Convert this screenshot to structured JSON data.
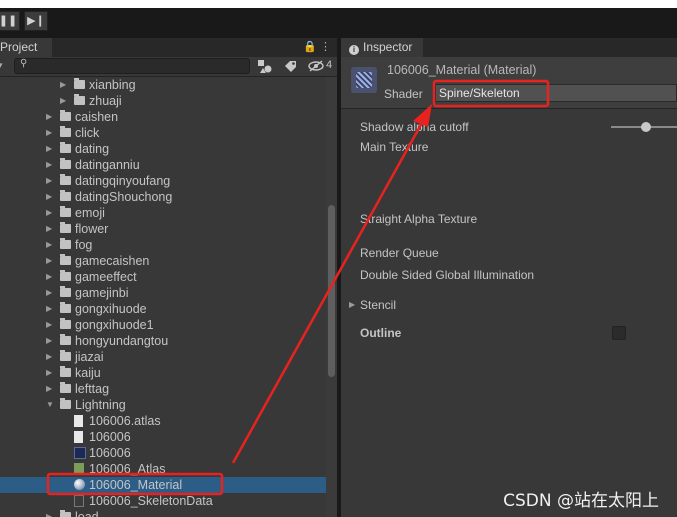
{
  "toolbar": {
    "pause_glyph": "❚❚",
    "step_glyph": "▶❙"
  },
  "project": {
    "tab_label": "Project",
    "tab_icons": "🔒 ⋮",
    "add_glyph": "▾",
    "visible_count": "4",
    "items": [
      {
        "label": "xianbing",
        "type": "folder",
        "depth": 2,
        "expanded": false
      },
      {
        "label": "zhuaji",
        "type": "folder",
        "depth": 2,
        "expanded": false
      },
      {
        "label": "caishen",
        "type": "folder",
        "depth": 1,
        "expanded": false
      },
      {
        "label": "click",
        "type": "folder",
        "depth": 1,
        "expanded": false
      },
      {
        "label": "dating",
        "type": "folder",
        "depth": 1,
        "expanded": false
      },
      {
        "label": "datinganniu",
        "type": "folder",
        "depth": 1,
        "expanded": false
      },
      {
        "label": "datingqinyoufang",
        "type": "folder",
        "depth": 1,
        "expanded": false
      },
      {
        "label": "datingShouchong",
        "type": "folder",
        "depth": 1,
        "expanded": false
      },
      {
        "label": "emoji",
        "type": "folder",
        "depth": 1,
        "expanded": false
      },
      {
        "label": "flower",
        "type": "folder",
        "depth": 1,
        "expanded": false
      },
      {
        "label": "fog",
        "type": "folder",
        "depth": 1,
        "expanded": false
      },
      {
        "label": "gamecaishen",
        "type": "folder",
        "depth": 1,
        "expanded": false
      },
      {
        "label": "gameeffect",
        "type": "folder",
        "depth": 1,
        "expanded": false
      },
      {
        "label": "gamejinbi",
        "type": "folder",
        "depth": 1,
        "expanded": false
      },
      {
        "label": "gongxihuode",
        "type": "folder",
        "depth": 1,
        "expanded": false
      },
      {
        "label": "gongxihuode1",
        "type": "folder",
        "depth": 1,
        "expanded": false
      },
      {
        "label": "hongyundangtou",
        "type": "folder",
        "depth": 1,
        "expanded": false
      },
      {
        "label": "jiazai",
        "type": "folder",
        "depth": 1,
        "expanded": false
      },
      {
        "label": "kaiju",
        "type": "folder",
        "depth": 1,
        "expanded": false
      },
      {
        "label": "lefttag",
        "type": "folder",
        "depth": 1,
        "expanded": false
      },
      {
        "label": "Lightning",
        "type": "folder",
        "depth": 1,
        "expanded": true
      },
      {
        "label": "106006.atlas",
        "type": "doc",
        "depth": 2
      },
      {
        "label": "106006",
        "type": "doc",
        "depth": 2
      },
      {
        "label": "106006",
        "type": "image",
        "depth": 2
      },
      {
        "label": "106006_Atlas",
        "type": "atlas",
        "depth": 2
      },
      {
        "label": "106006_Material",
        "type": "material",
        "depth": 2,
        "selected": true
      },
      {
        "label": "106006_SkeletonData",
        "type": "skeleton",
        "depth": 2
      },
      {
        "label": "load",
        "type": "folder",
        "depth": 1,
        "expanded": false
      }
    ]
  },
  "inspector": {
    "tab_label": "Inspector",
    "material_title": "106006_Material (Material)",
    "shader_label": "Shader",
    "shader_value": "Spine/Skeleton",
    "properties": {
      "shadow_cutoff": "Shadow alpha cutoff",
      "main_texture": "Main Texture",
      "straight_alpha": "Straight Alpha Texture",
      "render_queue": "Render Queue",
      "double_sided_gi": "Double Sided Global Illumination",
      "stencil": "Stencil",
      "outline": "Outline"
    }
  },
  "annotation_color": "#e8231f",
  "watermark": "CSDN @站在太阳上"
}
